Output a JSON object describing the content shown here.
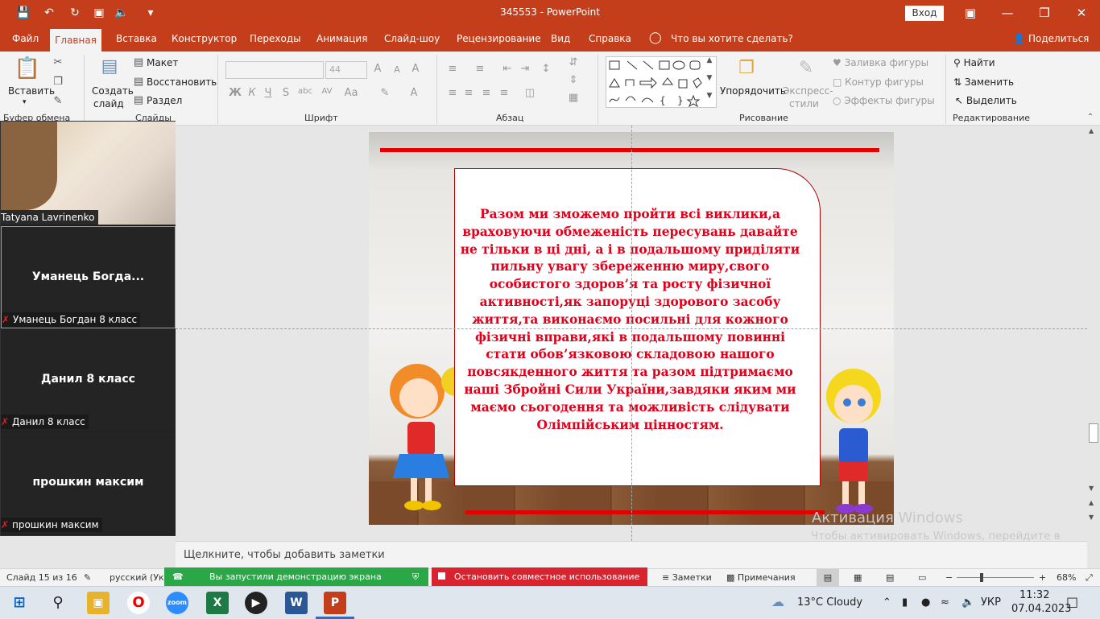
{
  "window": {
    "title": "345553  -  PowerPoint",
    "signin_label": "Вход",
    "share_label": "Поделиться"
  },
  "ribbon_tabs": [
    "Файл",
    "Главная",
    "Вставка",
    "Конструктор",
    "Переходы",
    "Анимация",
    "Слайд-шоу",
    "Рецензирование",
    "Вид",
    "Справка"
  ],
  "tell_me": "Что вы хотите сделать?",
  "ribbon": {
    "clipboard": {
      "paste": "Вставить",
      "group": "Буфер обмена"
    },
    "slides": {
      "new_slide_1": "Создать",
      "new_slide_2": "слайд",
      "layout": "Макет",
      "reset": "Восстановить",
      "section": "Раздел",
      "group": "Слайды"
    },
    "font": {
      "size": "44",
      "group": "Шрифт"
    },
    "paragraph": {
      "group": "Абзац"
    },
    "drawing": {
      "arrange": "Упорядочить",
      "quick_styles_1": "Экспресс-",
      "quick_styles_2": "стили",
      "fill": "Заливка фигуры",
      "outline": "Контур фигуры",
      "effects": "Эффекты фигуры",
      "group": "Рисование"
    },
    "editing": {
      "find": "Найти",
      "replace": "Заменить",
      "select": "Выделить",
      "group": "Редактирование"
    }
  },
  "slide": {
    "text": "Разом ми зможемо пройти всі виклики,а враховуючи обмеженість пересувань давайте не тільки в ці дні, а і в подальшому приділяти  пильну увагу збереженню миру,свого особистого здоров’я та росту фізичної активності,як запоруці здорового засобу життя,та виконаємо посильні для кожного фізичні вправи,які в подальшому повинні стати обов’язковою складовою нашого повсякденного життя та разом підтримаємо наші Збройні Сили України,завдяки яким  ми маємо сьогодення та можливість слідувати Олімпійським цінностям."
  },
  "notes_placeholder": "Щелкните, чтобы добавить заметки",
  "watermark": {
    "line1": "Активация Windows",
    "line2": "Чтобы активировать Windows, перейдите в раздел \"Параметры\"."
  },
  "participants": [
    {
      "tile_name": "",
      "tag": "Tatyana Lavrinenko"
    },
    {
      "tile_name": "Уманець  Богда...",
      "tag": "Уманець Богдан 8 класс"
    },
    {
      "tile_name": "Данил 8 класс",
      "tag": "Данил 8 класс"
    },
    {
      "tile_name": "прошкин максим",
      "tag": "прошкин максим"
    }
  ],
  "status": {
    "slide_count": "Слайд 15 из 16",
    "language": "русский (Укр",
    "sharing": "Вы запустили демонстрацию экрана",
    "stop_sharing": "Остановить совместное использование",
    "notes": "Заметки",
    "comments": "Примечания",
    "zoom": "68%"
  },
  "taskbar": {
    "weather": "13°C  Cloudy",
    "lang": "УКР",
    "time": "11:32",
    "date": "07.04.2023"
  },
  "colors": {
    "accent": "#c43e1c",
    "slide_text": "#e0001b",
    "share_green": "#2aa746",
    "share_red": "#d9232e"
  }
}
